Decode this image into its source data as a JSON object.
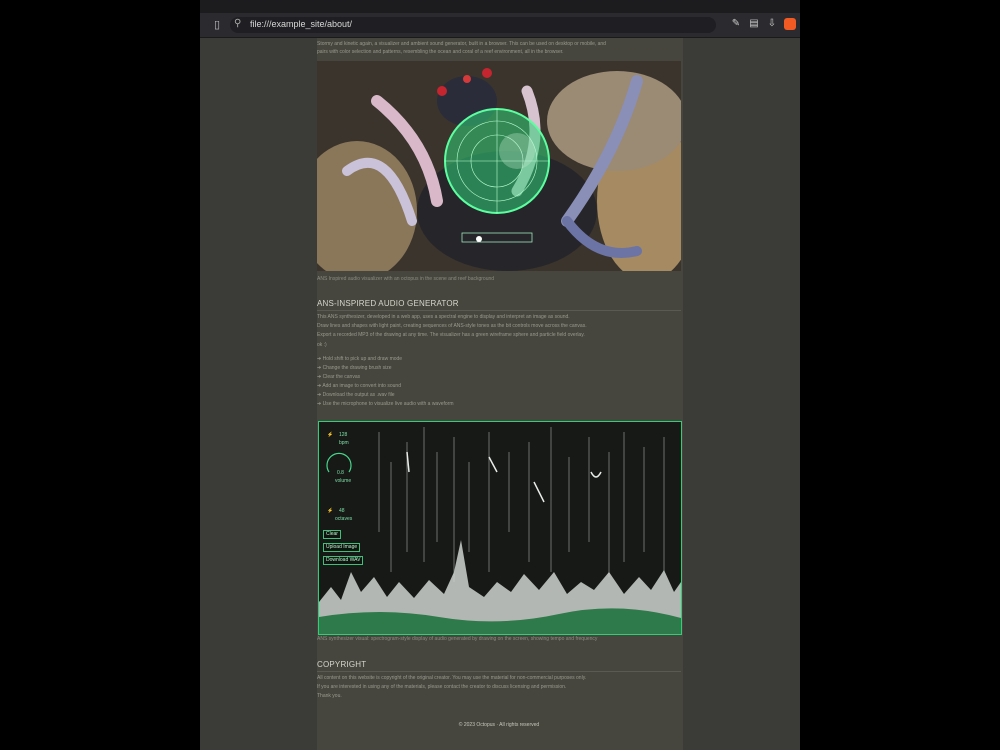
{
  "browser": {
    "url": "file:///example_site/about/"
  },
  "page": {
    "intro_lines": [
      "Stormy and kinetic again, a visualizer and ambient sound generator, built in a browser. This can be used on desktop or mobile, and",
      "pairs with color selection and patterns, resembling the ocean and coral of a reef environment, all in the browser."
    ],
    "hero_caption": "ANS Inspired audio visualizer with an octopus in the scene and reef background",
    "section1_title": "ANS-INSPIRED AUDIO GENERATOR",
    "section1_lines": [
      "This ANS synthesizer, developed in a web app, uses a spectral engine to display and interpret an image as sound.",
      "Draw lines and shapes with light paint, creating sequences of ANS-style tones as the bit controls move across the canvas.",
      "Export a recorded MP3 of the drawing at any time. The visualizer has a green wireframe sphere and particle field overlay.",
      "ok :)"
    ],
    "bullets": [
      "Hold shift to pick up and draw mode",
      "Change the drawing brush size",
      "Clear the canvas",
      "Add an image to convert into sound",
      "Download the output as .wav file",
      "Use the microphone to visualize live audio with a waveform"
    ],
    "viz_caption": "ANS synthesizer visual: spectrogram-style display of audio generated by drawing on the screen, showing tempo and frequency",
    "section2_title": "COPYRIGHT",
    "section2_lines": [
      "All content on this website is copyright of the original creator. You may use the material for non-commercial purposes only.",
      "If you are interested in using any of the materials, please contact the creator to discuss licensing and permission.",
      "Thank you."
    ],
    "footer": "© 2023 Octopus · All rights reserved"
  },
  "visualizer": {
    "bpm_label": "128",
    "bpm_unit": "bpm",
    "gain_label": "0.8",
    "gain_unit": "volume",
    "freq_label": "48",
    "freq_unit": "octaves",
    "btn_clear": "Clear",
    "btn_image": "Upload Image",
    "btn_download": "Download WAV",
    "accent": "#2fcf76"
  },
  "icons": {
    "sidebar": "sidebar-icon",
    "search": "search-icon",
    "lock": "lock-icon",
    "share": "share-icon",
    "extensions": "puzzle-icon",
    "brave": "brave-logo-icon"
  }
}
